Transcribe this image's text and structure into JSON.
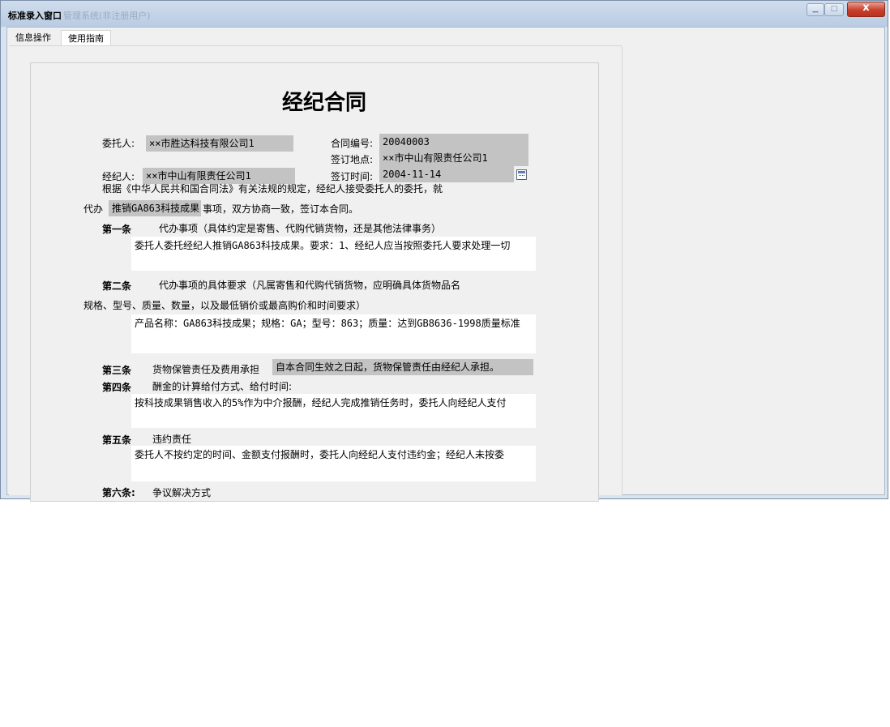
{
  "window": {
    "title": "标准录入窗口",
    "title_background": "管理系统(非注册用户)",
    "close_glyph": "x"
  },
  "tabs": [
    {
      "label": "信息操作"
    },
    {
      "label": "使用指南"
    }
  ],
  "form": {
    "heading": "经纪合同",
    "client_label": "委托人:",
    "client_value": "××市胜达科技有限公司1",
    "broker_label": "经纪人:",
    "broker_value": "××市中山有限责任公司1",
    "contract_no_label": "合同编号:",
    "contract_no_value": "20040003",
    "sign_place_label": "签订地点:",
    "sign_place_value": "××市中山有限责任公司1",
    "sign_time_label": "签订时间:",
    "sign_time_value": "2004-11-14",
    "intro_line1": "根据《中华人民共和国合同法》有关法规的规定，经纪人接受委托人的委托，就",
    "intro_prefix": "代办",
    "intro_field": "推销GA863科技成果",
    "intro_suffix": "事项，双方协商一致，签订本合同。",
    "art1_title": "第一条",
    "art1_text": "代办事项（具体约定是寄售、代购代销货物，还是其他法律事务）",
    "art1_value": "委托人委托经纪人推销GA863科技成果。要求：1、经纪人应当按照委托人要求处理一切",
    "art2_title": "第二条",
    "art2_text": "代办事项的具体要求（凡属寄售和代购代销货物，应明确具体货物品名",
    "art2_text2": "规格、型号、质量、数量，以及最低销价或最高购价和时间要求）",
    "art2_value": "产品名称：GA863科技成果；规格：GA；型号：863；质量：达到GB8636-1998质量标准",
    "art3_title": "第三条",
    "art3_text": "货物保管责任及费用承担",
    "art3_value": "自本合同生效之日起，货物保管责任由经纪人承担。",
    "art4_title": "第四条",
    "art4_text": "酬金的计算给付方式、给付时间:",
    "art4_value": "按科技成果销售收入的5%作为中介报酬，经纪人完成推销任务时，委托人向经纪人支付",
    "art5_title": "第五条",
    "art5_text": "违约责任",
    "art5_value": "委托人不按约定的时间、金额支付报酬时，委托人向经纪人支付违约金；经纪人未按委",
    "art6_title": "第六条:",
    "art6_text": "争议解决方式"
  }
}
